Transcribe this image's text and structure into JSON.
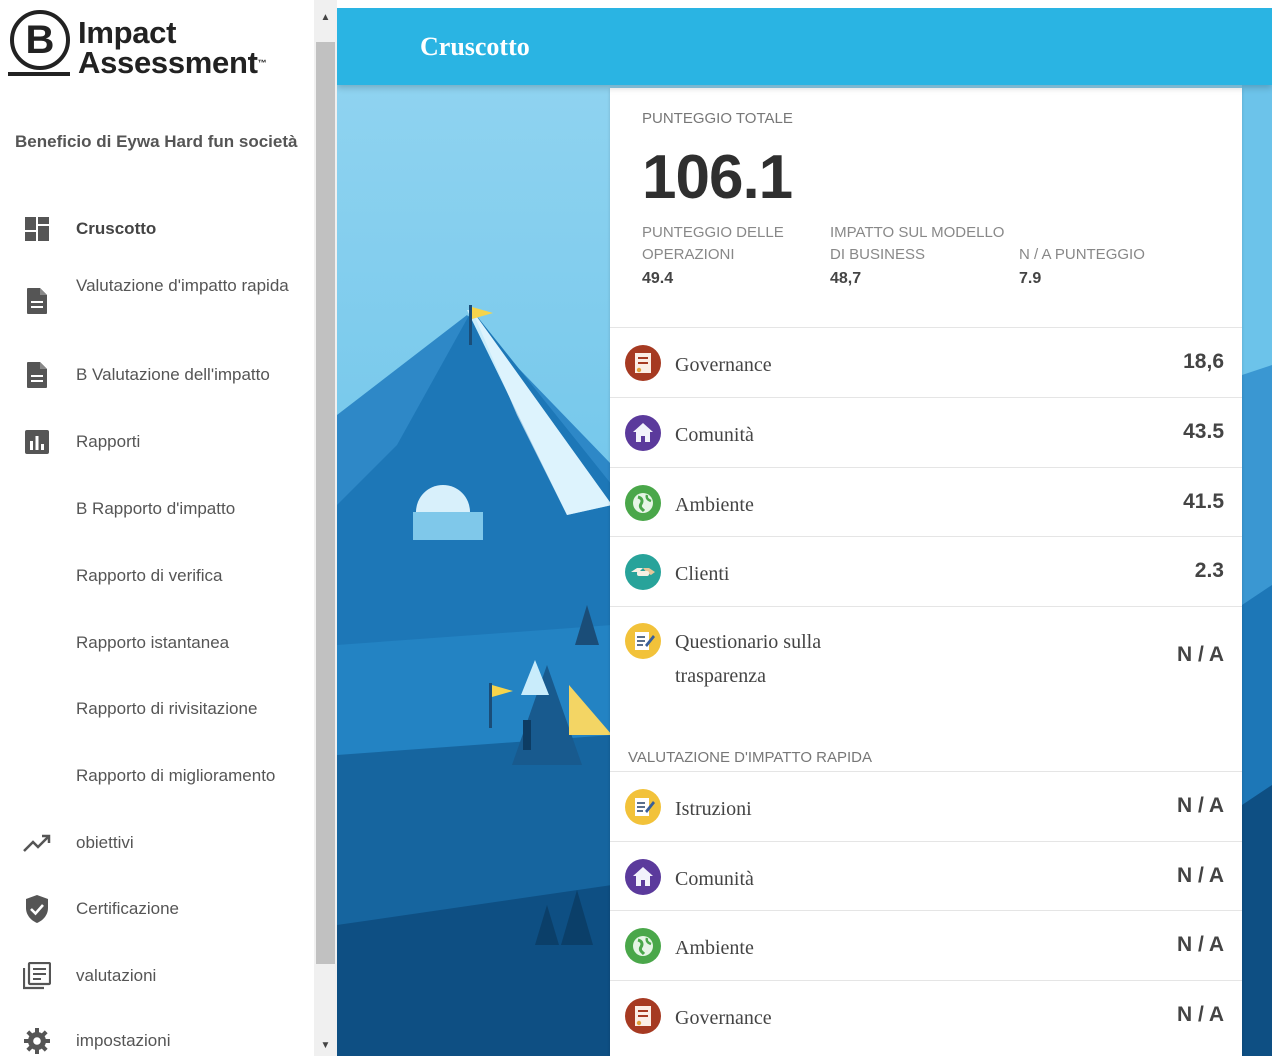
{
  "logo": {
    "letter": "B",
    "line1": "Impact",
    "line2": "Assessment",
    "tm": "™"
  },
  "sidebar": {
    "company": "Beneficio di Eywa Hard fun società",
    "items": [
      {
        "label": "Cruscotto",
        "icon": "dashboard-icon"
      },
      {
        "label": "Valutazione d'impatto rapida",
        "icon": "document-icon"
      },
      {
        "label": "B Valutazione dell'impatto",
        "icon": "document-icon"
      },
      {
        "label": "Rapporti",
        "icon": "bar-chart-icon"
      },
      {
        "label": "B Rapporto d'impatto"
      },
      {
        "label": "Rapporto di verifica"
      },
      {
        "label": "Rapporto istantanea"
      },
      {
        "label": "Rapporto di rivisitazione"
      },
      {
        "label": "Rapporto di miglioramento"
      },
      {
        "label": "obiettivi",
        "icon": "trending-up-icon"
      },
      {
        "label": "Certificazione",
        "icon": "shield-check-icon"
      },
      {
        "label": "valutazioni",
        "icon": "list-icon"
      },
      {
        "label": "impostazioni",
        "icon": "gear-icon"
      }
    ]
  },
  "header": {
    "title": "Cruscotto"
  },
  "summary": {
    "total_label": "PUNTEGGIO TOTALE",
    "total_value": "106.1",
    "operations_label": "PUNTEGGIO DELLE OPERAZIONI",
    "operations_value": "49.4",
    "business_label": "IMPATTO SUL MODELLO DI BUSINESS",
    "business_value": "48,7",
    "na_label": "N / A PUNTEGGIO",
    "na_value": "7.9"
  },
  "categories": [
    {
      "label": "Governance",
      "score": "18,6",
      "icon": "governance-icon",
      "color": "#a63a22"
    },
    {
      "label": "Comunità",
      "score": "43.5",
      "icon": "community-icon",
      "color": "#5b3a9c"
    },
    {
      "label": "Ambiente",
      "score": "41.5",
      "icon": "environment-icon",
      "color": "#4aa74a"
    },
    {
      "label": "Clienti",
      "score": "2.3",
      "icon": "customers-icon",
      "color": "#28a39a"
    },
    {
      "label": "Questionario sulla trasparenza",
      "score": "N / A",
      "icon": "questionnaire-icon",
      "color": "#f2c23a"
    }
  ],
  "quick": {
    "section_label": "VALUTAZIONE D'IMPATTO RAPIDA",
    "items": [
      {
        "label": "Istruzioni",
        "score": "N / A",
        "icon": "instructions-icon",
        "color": "#f2c23a"
      },
      {
        "label": "Comunità",
        "score": "N / A",
        "icon": "community-icon",
        "color": "#5b3a9c"
      },
      {
        "label": "Ambiente",
        "score": "N / A",
        "icon": "environment-icon",
        "color": "#4aa74a"
      },
      {
        "label": "Governance",
        "score": "N / A",
        "icon": "governance-icon",
        "color": "#a63a22"
      }
    ]
  }
}
